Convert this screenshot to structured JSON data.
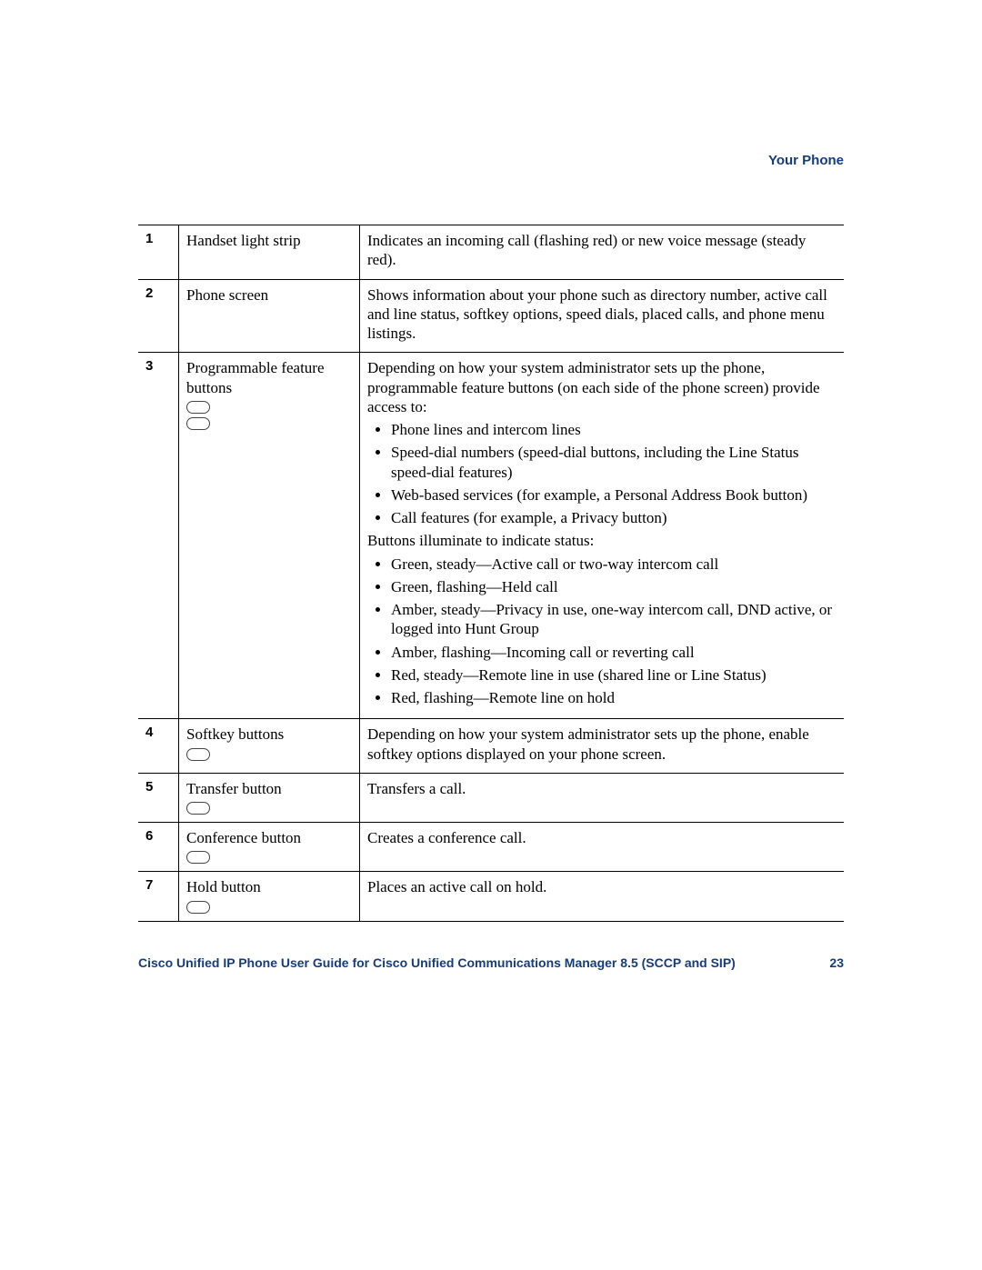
{
  "header": {
    "section": "Your Phone"
  },
  "rows": [
    {
      "num": "1",
      "name": "Handset light strip",
      "icons": 0,
      "desc_intro": "Indicates an incoming call (flashing red) or new voice message (steady red).",
      "list1": [],
      "desc_mid": "",
      "list2": []
    },
    {
      "num": "2",
      "name": "Phone screen",
      "icons": 0,
      "desc_intro": "Shows information about your phone such as directory number, active call and line status, softkey options, speed dials, placed calls, and phone menu listings.",
      "list1": [],
      "desc_mid": "",
      "list2": []
    },
    {
      "num": "3",
      "name": "Programmable feature buttons",
      "icons": 2,
      "desc_intro": "Depending on how your system administrator sets up the phone, programmable feature buttons (on each side of the phone screen) provide access to:",
      "list1": [
        "Phone lines and intercom lines",
        "Speed-dial numbers (speed-dial buttons, including the Line Status speed-dial features)",
        "Web-based services (for example, a Personal Address Book button)",
        "Call features (for example, a Privacy button)"
      ],
      "desc_mid": "Buttons illuminate to indicate status:",
      "list2": [
        "Green, steady—Active call or two-way intercom call",
        "Green, flashing—Held call",
        "Amber, steady—Privacy in use, one-way intercom call, DND active, or logged into Hunt Group",
        "Amber, flashing—Incoming call or reverting call",
        "Red, steady—Remote line in use (shared line or Line Status)",
        "Red, flashing—Remote line on hold"
      ]
    },
    {
      "num": "4",
      "name": "Softkey buttons",
      "icons": 1,
      "desc_intro": "Depending on how your system administrator sets up the phone, enable softkey options displayed on your phone screen.",
      "list1": [],
      "desc_mid": "",
      "list2": []
    },
    {
      "num": "5",
      "name": "Transfer button",
      "icons": 1,
      "desc_intro": "Transfers a call.",
      "list1": [],
      "desc_mid": "",
      "list2": []
    },
    {
      "num": "6",
      "name": "Conference button",
      "icons": 1,
      "desc_intro": "Creates a conference call.",
      "list1": [],
      "desc_mid": "",
      "list2": []
    },
    {
      "num": "7",
      "name": "Hold button",
      "icons": 1,
      "desc_intro": "Places an active call on hold.",
      "list1": [],
      "desc_mid": "",
      "list2": []
    }
  ],
  "footer": {
    "title": "Cisco Unified IP Phone User Guide for Cisco Unified Communications Manager 8.5 (SCCP and SIP)",
    "page": "23"
  }
}
